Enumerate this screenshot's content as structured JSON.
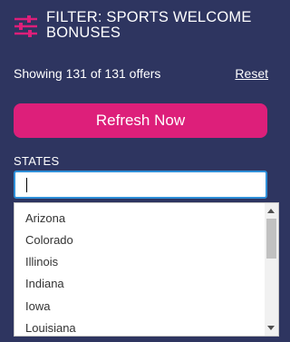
{
  "header": {
    "title": "FILTER: SPORTS WELCOME BONUSES",
    "icon": "filter-sliders-icon",
    "accent_color": "#dd1f7a"
  },
  "summary": {
    "showing_text": "Showing 131 of 131 offers",
    "reset_label": "Reset"
  },
  "refresh": {
    "label": "Refresh Now",
    "color": "#dd1f7a"
  },
  "states": {
    "label": "STATES",
    "value": "",
    "options": [
      "Arizona",
      "Colorado",
      "Illinois",
      "Indiana",
      "Iowa",
      "Louisiana"
    ]
  },
  "theme": {
    "background": "#2e3560",
    "input_focus_border": "#2f8fd8"
  }
}
